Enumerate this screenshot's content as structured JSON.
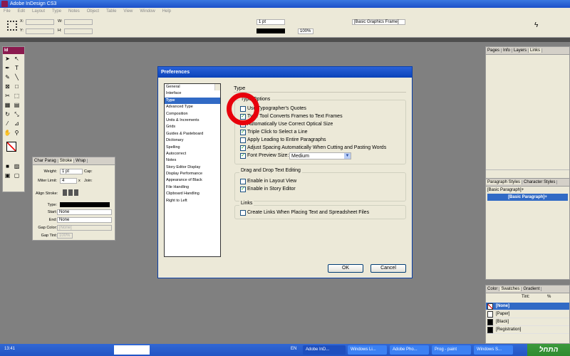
{
  "window": {
    "title": "Adobe InDesign CS3"
  },
  "menu": [
    "File",
    "Edit",
    "Layout",
    "Type",
    "Notes",
    "Object",
    "Table",
    "View",
    "Window",
    "Help"
  ],
  "control": {
    "x_label": "X:",
    "y_label": "Y:",
    "w_label": "W:",
    "h_label": "H:",
    "stroke_weight": "1 pt",
    "zoom": "100%",
    "object_style": "[Basic Graphics Frame]"
  },
  "tools": {
    "logo": "Id"
  },
  "stroke_panel": {
    "tabs": [
      "Char Parag",
      "Stroke",
      "Wrap"
    ],
    "weight_label": "Weight:",
    "weight": "1 pt",
    "cap_label": "Cap:",
    "miter_label": "Miter Limit:",
    "miter": "4",
    "x_label": "x",
    "join_label": "Join:",
    "align_label": "Align Stroke:",
    "type_label": "Type:",
    "start_label": "Start:",
    "start": "None",
    "end_label": "End:",
    "end": "None",
    "gap_color_label": "Gap Color:",
    "gap_color": "[None]",
    "gap_tint_label": "Gap Tint:",
    "gap_tint": "100%"
  },
  "dialog": {
    "title": "Preferences",
    "categories": [
      "General",
      "Interface",
      "Type",
      "Advanced Type",
      "Composition",
      "Units & Increments",
      "Grids",
      "Guides & Pasteboard",
      "Dictionary",
      "Spelling",
      "Autocorrect",
      "Notes",
      "Story Editor Display",
      "Display Performance",
      "Appearance of Black",
      "File Handling",
      "Clipboard Handling",
      "Right to Left"
    ],
    "selected_category": "Type",
    "section_title": "Type",
    "type_options": {
      "title": "Type Options",
      "items": [
        {
          "label": "Use Typographer's Quotes",
          "checked": false
        },
        {
          "label": "Type Tool Converts Frames to Text Frames",
          "checked": true
        },
        {
          "label": "Automatically Use Correct Optical Size",
          "checked": true
        },
        {
          "label": "Triple Click to Select a Line",
          "checked": true
        },
        {
          "label": "Apply Leading to Entire Paragraphs",
          "checked": false
        },
        {
          "label": "Adjust Spacing Automatically When Cutting and Pasting Words",
          "checked": true
        },
        {
          "label": "Font Preview Size:",
          "checked": true
        }
      ],
      "font_preview_size": "Medium"
    },
    "drag_drop": {
      "title": "Drag and Drop Text Editing",
      "items": [
        {
          "label": "Enable in Layout View",
          "checked": false
        },
        {
          "label": "Enable in Story Editor",
          "checked": true
        }
      ]
    },
    "links": {
      "title": "Links",
      "items": [
        {
          "label": "Create Links When Placing Text and Spreadsheet Files",
          "checked": false
        }
      ]
    },
    "ok": "OK",
    "cancel": "Cancel"
  },
  "links_panel": {
    "tabs": [
      "Pages",
      "Info",
      "Layers",
      "Links"
    ]
  },
  "para_panel": {
    "tabs": [
      "Paragraph Styles",
      "Character Styles"
    ],
    "current": "[Basic Paragraph]+",
    "items": [
      "[Basic Paragraph]+"
    ]
  },
  "swatch_panel": {
    "tabs": [
      "Color",
      "Swatches",
      "Gradient"
    ],
    "tint_label": "Tint:",
    "tint_unit": "%",
    "items": [
      "[None]",
      "[Paper]",
      "[Black]",
      "[Registration]"
    ]
  },
  "taskbar": {
    "clock": "13:41",
    "lang": "EN",
    "tasks": [
      "Adobe InD...",
      "Windows Li...",
      "Adobe Pho...",
      "Prog - paint",
      "Windows S..."
    ],
    "start": "התחל"
  }
}
